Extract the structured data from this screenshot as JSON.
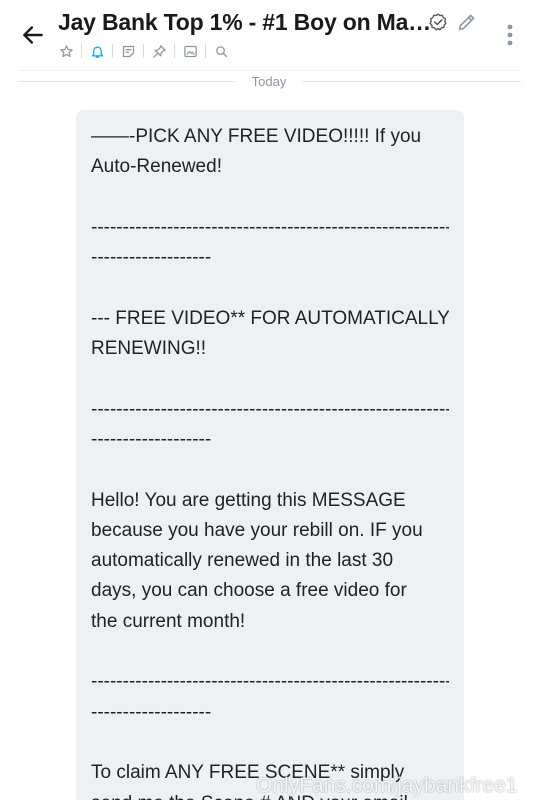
{
  "header": {
    "title": "Jay Bank Top 1% - #1 Boy on Ma…",
    "icons": {
      "back": "arrow-left-icon",
      "verified": "verified-badge-icon",
      "edit": "pencil-icon",
      "more": "more-vertical-icon"
    },
    "toolbar": [
      "star-icon",
      "bell-icon",
      "note-icon",
      "pin-icon",
      "image-icon",
      "search-icon"
    ],
    "accent_color": "#00aff0"
  },
  "date_divider": "Today",
  "message": {
    "lines": [
      "——-PICK ANY FREE VIDEO!!!!! If you",
      "Auto-Renewed!",
      "",
      "--------------------------------------------------------------",
      "-------------------",
      "",
      "--- FREE VIDEO** FOR AUTOMATICALLY",
      "RENEWING!!",
      "",
      "--------------------------------------------------------------",
      "-------------------",
      "",
      "Hello! You are getting this MESSAGE",
      "because you have your rebill on. IF you",
      "automatically renewed in the last 30",
      "days, you can choose a free video for",
      "the current month!",
      "",
      "--------------------------------------------------------------",
      "-------------------",
      "",
      "To claim ANY FREE SCENE** simply",
      "send me the Scene # AND your email"
    ]
  },
  "watermark": "OnlyFans.com/jaybankfree1"
}
